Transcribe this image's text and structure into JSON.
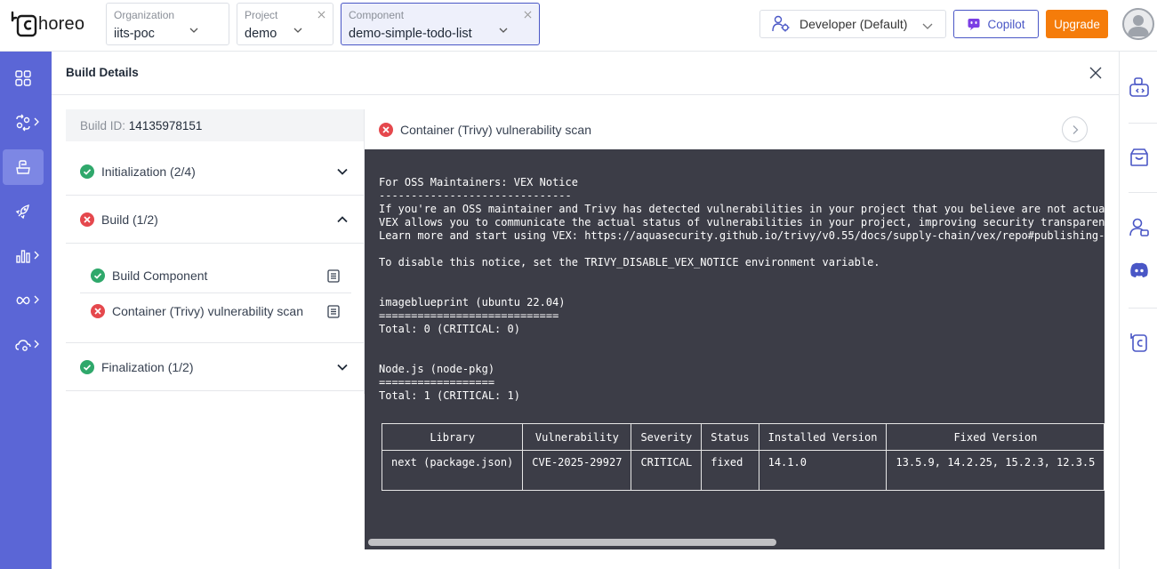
{
  "brand": {
    "name": "horeo"
  },
  "selectors": {
    "organization": {
      "label": "Organization",
      "value": "iits-poc"
    },
    "project": {
      "label": "Project",
      "value": "demo"
    },
    "component": {
      "label": "Component",
      "value": "demo-simple-todo-list"
    }
  },
  "role": {
    "label": "Developer (Default)"
  },
  "copilot": {
    "label": "Copilot"
  },
  "upgrade": {
    "label": "Upgrade"
  },
  "panel": {
    "title": "Build Details"
  },
  "build": {
    "id_label": "Build ID:",
    "id_value": "14135978151"
  },
  "stages": [
    {
      "label": "Initialization (2/4)",
      "status": "success"
    },
    {
      "label": "Build (1/2)",
      "status": "failed"
    },
    {
      "label": "Finalization (1/2)",
      "status": "success"
    }
  ],
  "build_steps": [
    {
      "label": "Build Component",
      "status": "success"
    },
    {
      "label": "Container (Trivy) vulnerability scan",
      "status": "failed"
    }
  ],
  "log": {
    "title": "Container (Trivy) vulnerability scan",
    "lines": "For OSS Maintainers: VEX Notice\n------------------------------\nIf you're an OSS maintainer and Trivy has detected vulnerabilities in your project that you believe are not actually exploitable, consider issuing a VEX (Vulnerability Exploitability eXchange) statement.\nVEX allows you to communicate the actual status of vulnerabilities in your project, improving security transparency and reducing false positives for your users.\nLearn more and start using VEX: https://aquasecurity.github.io/trivy/v0.55/docs/supply-chain/vex/repo#publishing-vex-documents\n\nTo disable this notice, set the TRIVY_DISABLE_VEX_NOTICE environment variable.\n\n\nimageblueprint (ubuntu 22.04)\n============================\nTotal: 0 (CRITICAL: 0)\n\n\nNode.js (node-pkg)\n==================\nTotal: 1 (CRITICAL: 1)",
    "table": {
      "headers": [
        "Library",
        "Vulnerability",
        "Severity",
        "Status",
        "Installed Version",
        "Fixed Version"
      ],
      "rows": [
        [
          "next (package.json)",
          "CVE-2025-29927",
          "CRITICAL",
          "fixed",
          "14.1.0",
          "13.5.9, 14.2.25, 15.2.3, 12.3.5"
        ]
      ]
    }
  },
  "colors": {
    "accent": "#5b66d6",
    "success": "#2fa86b",
    "error": "#e5484d",
    "upgrade": "#f57c0a",
    "terminal": "#3c3d47"
  }
}
